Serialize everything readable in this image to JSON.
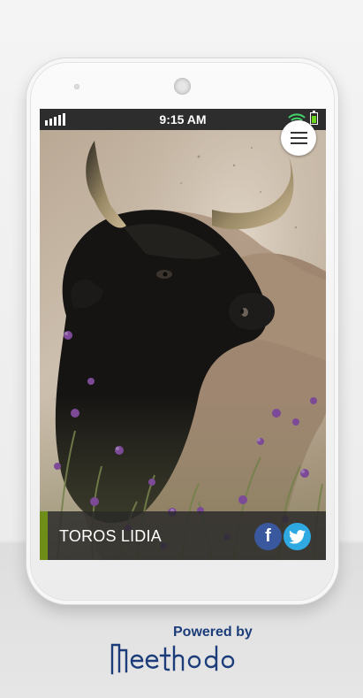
{
  "status_bar": {
    "time": "9:15 AM"
  },
  "hero": {
    "title": "TOROS LIDIA"
  },
  "social": {
    "facebook_glyph": "f",
    "twitter_icon": "twitter-bird-icon"
  },
  "branding": {
    "powered_by": "Powered by",
    "logo_text": "Meethodo"
  },
  "colors": {
    "accent": "#6f8e19",
    "facebook": "#3a589e",
    "twitter": "#2ea9e1",
    "brand": "#1c3d7a",
    "battery": "#69d51c",
    "wifi": "#46d36a"
  }
}
